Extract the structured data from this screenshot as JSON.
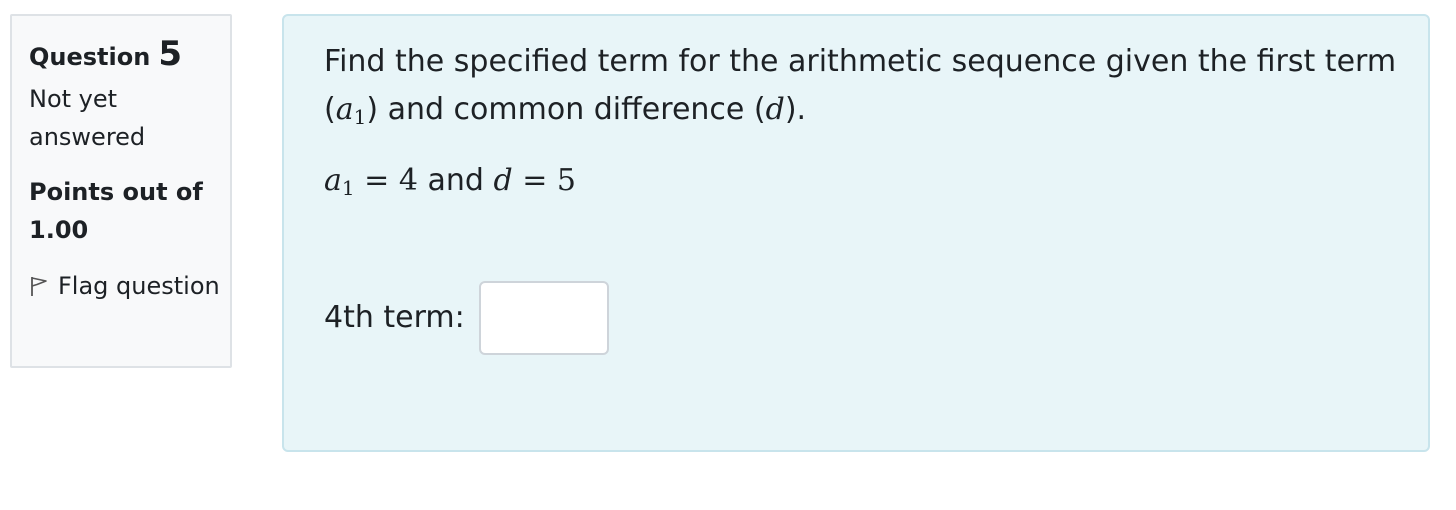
{
  "question_info": {
    "question_word": "Question",
    "question_number": "5",
    "state": "Not yet answered",
    "grade": "Points out of 1.00",
    "flag_label": "Flag question",
    "flag_icon": "flag-outline-icon"
  },
  "question": {
    "text_part1": "Find the specified term for the arithmetic sequence given the first term (",
    "a_symbol": "a",
    "a_subscript": "1",
    "text_part2": ") and common difference (",
    "d_symbol": "d",
    "text_part3": ").",
    "given": {
      "a_symbol": "a",
      "a_subscript": "1",
      "equals1": "= 4",
      "and": " and ",
      "d_symbol": "d",
      "equals2": "= 5"
    }
  },
  "answer": {
    "label": "4th term:",
    "value": "",
    "placeholder": ""
  },
  "colors": {
    "content_background": "#e8f5f8",
    "content_border": "#c8e4ec",
    "info_background": "#f8f9fa",
    "info_border": "#dee2e6",
    "text": "#1d2125"
  }
}
